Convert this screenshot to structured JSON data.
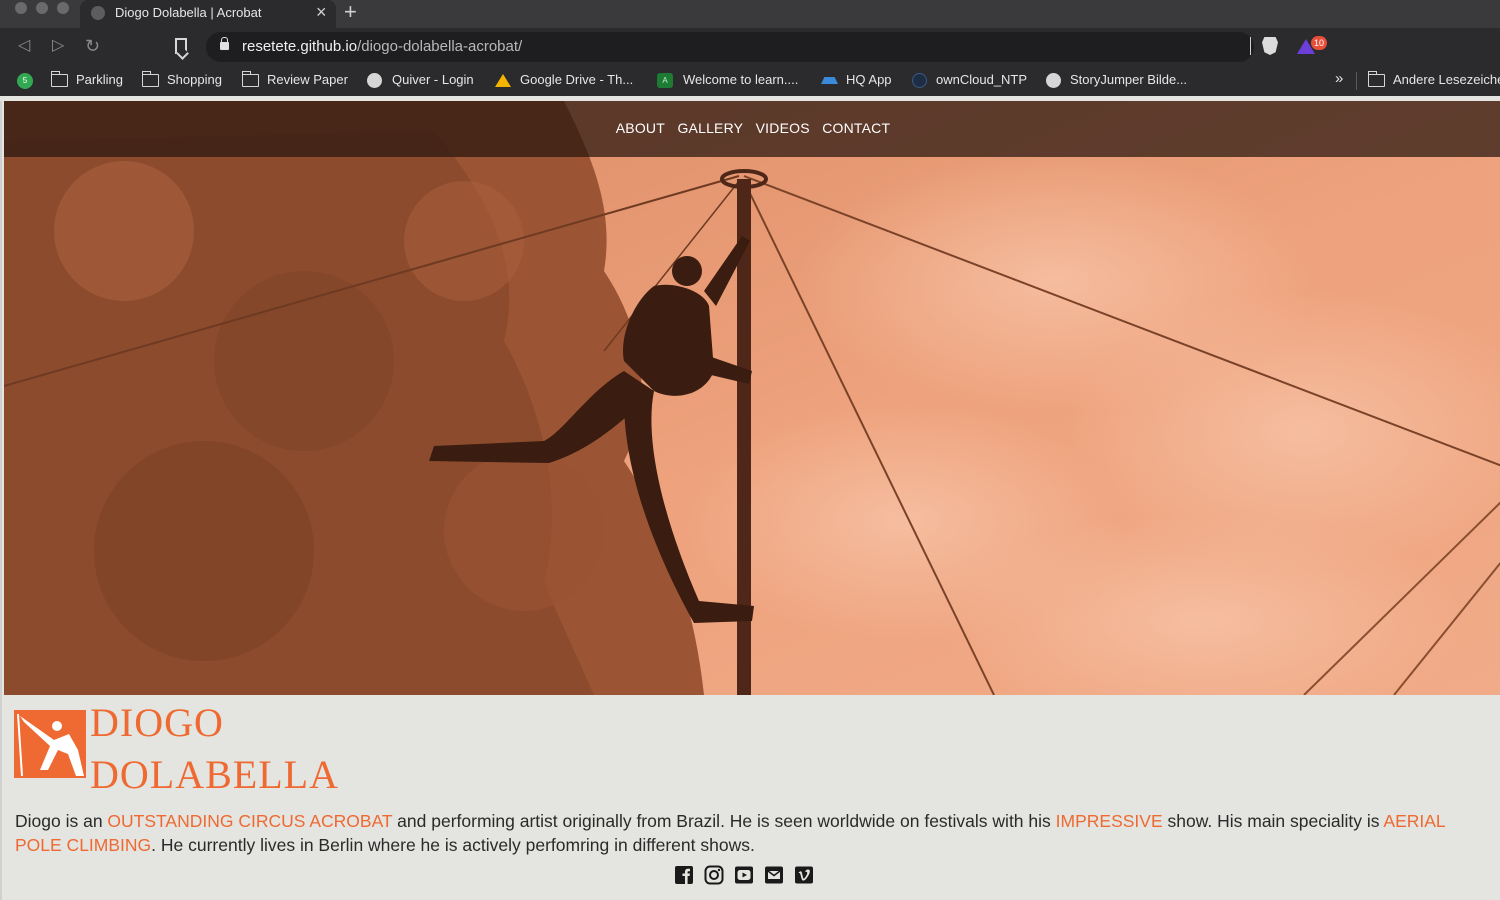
{
  "browser": {
    "tab_title": "Diogo Dolabella | Acrobat",
    "tab_close": "×",
    "new_tab": "+",
    "url_host": "resetete.github.io",
    "url_path": "/diogo-dolabella-acrobat/",
    "rewards_badge": "10",
    "whatsapp_badge": "5",
    "bookmarks": [
      {
        "label": "Parkling",
        "icon": "folder-icon"
      },
      {
        "label": "Shopping",
        "icon": "folder-icon"
      },
      {
        "label": "Review Paper",
        "icon": "folder-icon"
      },
      {
        "label": "Quiver - Login",
        "icon": "globe-icon"
      },
      {
        "label": "Google Drive - Th...",
        "icon": "google-drive-icon"
      },
      {
        "label": "Welcome to learn....",
        "icon": "learning-icon"
      },
      {
        "label": "HQ App",
        "icon": "hq-app-icon"
      },
      {
        "label": "ownCloud_NTP",
        "icon": "owncloud-icon"
      },
      {
        "label": "StoryJumper Bilde...",
        "icon": "globe-icon"
      },
      {
        "label": "Andere Lesezeichen",
        "icon": "folder-icon"
      }
    ],
    "more_bookmarks": "»"
  },
  "site": {
    "nav": [
      "ABOUT",
      "GALLERY",
      "VIDEOS",
      "CONTACT"
    ],
    "logo_line1": "DIOGO",
    "logo_line2": "DOLABELLA",
    "bio": {
      "p1": "Diogo is an ",
      "h1": "OUTSTANDING CIRCUS ACROBAT",
      "p2": " and performing artist originally from Brazil. He is seen worldwide on festivals with his ",
      "h2": "IMPRESSIVE",
      "p3": " show. His main speciality is ",
      "h3": "AERIAL POLE CLIMBING",
      "p4": ". He currently lives in Berlin where he is actively perfomring in different shows."
    },
    "social_icons": [
      "facebook-icon",
      "instagram-icon",
      "youtube-icon",
      "email-icon",
      "vimeo-icon"
    ],
    "accent_color": "#ee6a32"
  }
}
